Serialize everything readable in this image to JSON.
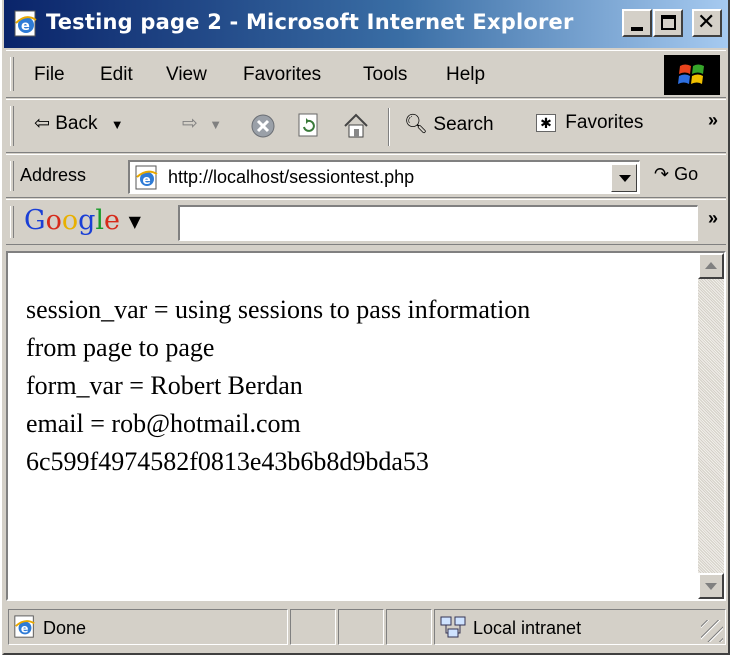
{
  "window": {
    "title": "Testing page 2 - Microsoft Internet Explorer"
  },
  "menubar": {
    "items": [
      "File",
      "Edit",
      "View",
      "Favorites",
      "Tools",
      "Help"
    ]
  },
  "toolbar": {
    "back_label": "Back",
    "search_label": "Search",
    "favorites_label": "Favorites",
    "more_glyph": "»"
  },
  "address_bar": {
    "label": "Address",
    "url": "http://localhost/sessiontest.php",
    "go_label": "Go"
  },
  "google_bar": {
    "logo_letters": [
      {
        "ch": "G",
        "color": "#1a3fd6"
      },
      {
        "ch": "o",
        "color": "#d62a1a"
      },
      {
        "ch": "o",
        "color": "#e8b000"
      },
      {
        "ch": "g",
        "color": "#1a3fd6"
      },
      {
        "ch": "l",
        "color": "#1a9b2a"
      },
      {
        "ch": "e",
        "color": "#d62a1a"
      }
    ],
    "search_value": "",
    "more_glyph": "»"
  },
  "content": {
    "lines": [
      "session_var = using sessions to pass information",
      "from page to page",
      "form_var = Robert Berdan",
      "email = rob@hotmail.com",
      "6c599f4974582f0813e43b6b8d9bda53"
    ]
  },
  "status_bar": {
    "status_text": "Done",
    "zone_text": "Local intranet"
  },
  "icons": {
    "ie": "ie-page-icon",
    "back": "back-arrow-icon",
    "forward": "forward-arrow-icon",
    "stop": "stop-icon",
    "refresh": "refresh-icon",
    "home": "home-icon",
    "search": "search-icon",
    "favorites": "favorites-icon",
    "go": "go-arrow-icon",
    "zone": "local-intranet-icon"
  },
  "colors": {
    "title_gradient_start": "#0a246a",
    "title_gradient_end": "#a6caf0",
    "chrome": "#d4d0c8"
  }
}
